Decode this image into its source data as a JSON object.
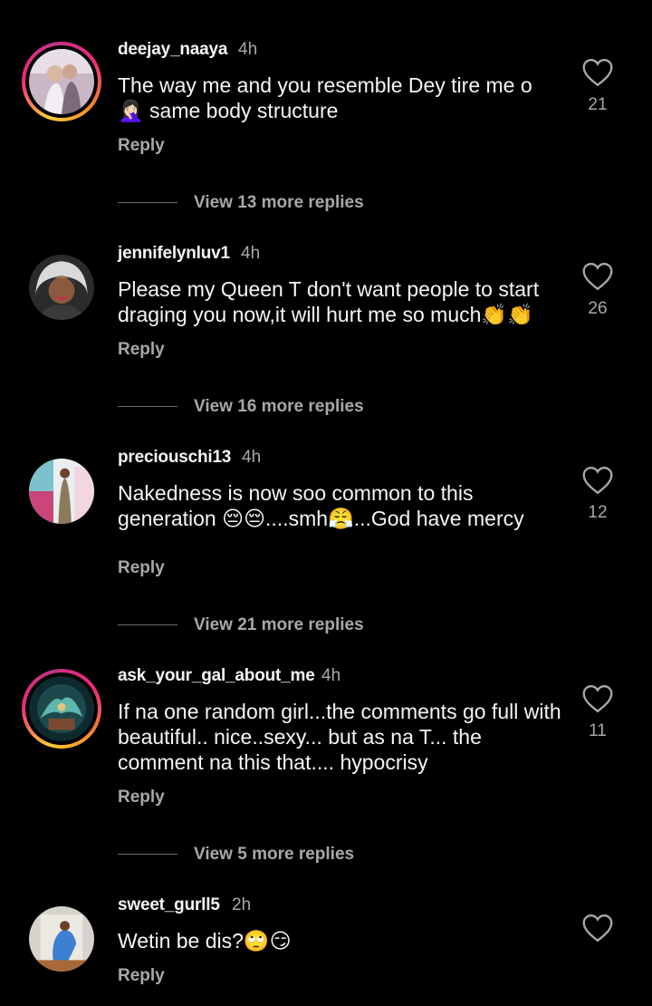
{
  "comments": [
    {
      "username": "deejay_naaya",
      "time": "4h",
      "text": "The way me and you resemble Dey tire me o 🤦🏻‍♀️ same body structure",
      "reply_label": "Reply",
      "likes": "21",
      "view_replies": "View 13 more replies",
      "avatar_ring": true
    },
    {
      "username": "jennifelynluv1",
      "time": "4h",
      "text": "Please my Queen T don't want people to start draging you now,it will hurt me so much👏👏",
      "reply_label": "Reply",
      "likes": "26",
      "view_replies": "View 16 more replies",
      "avatar_ring": false
    },
    {
      "username": "preciouschi13",
      "time": "4h",
      "text": "Nakedness is now soo common to this generation 😔😔....smh😤...God have mercy",
      "reply_label": "Reply",
      "likes": "12",
      "view_replies": "View 21 more replies",
      "avatar_ring": false
    },
    {
      "username": "ask_your_gal_about_me",
      "time": "4h",
      "text": "If na one random girl...the comments go full with beautiful.. nice..sexy... but as na T... the comment na this that.... hypocrisy",
      "reply_label": "Reply",
      "likes": "11",
      "view_replies": "View 5 more replies",
      "avatar_ring": true
    },
    {
      "username": "sweet_gurll5",
      "time": "2h",
      "text": "Wetin be dis?🙄😏",
      "reply_label": "Reply",
      "likes": "",
      "avatar_ring": false
    }
  ],
  "colors": {
    "background": "#000000",
    "primary_text": "#f5f5f5",
    "secondary_text": "#a8a8a8"
  },
  "icons": {
    "like": "heart-outline-icon"
  }
}
